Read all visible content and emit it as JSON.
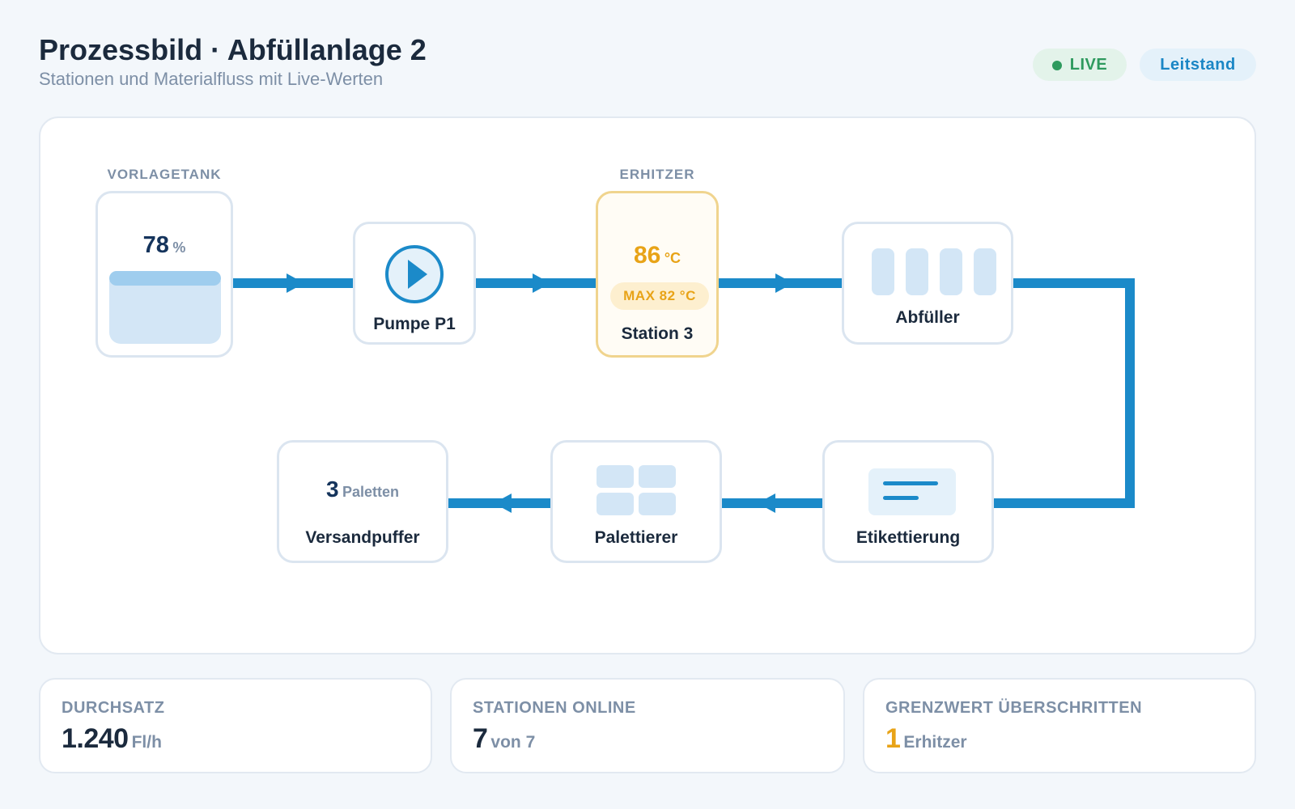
{
  "header": {
    "title": "Prozessbild · Abfüllanlage 2",
    "subtitle": "Stationen und Materialfluss mit Live-Werten"
  },
  "badges": {
    "live": "LIVE",
    "leitstand": "Leitstand"
  },
  "stations": {
    "tank": {
      "caption": "VORLAGETANK",
      "value": "78",
      "unit": "%",
      "fill_percent": 78,
      "icon": "tank-icon"
    },
    "pump": {
      "name": "Pumpe P1",
      "icon": "play-icon"
    },
    "heater": {
      "caption": "ERHITZER",
      "value": "86",
      "unit": "°C",
      "limit": "MAX 82 °C",
      "name": "Station 3"
    },
    "filler": {
      "name": "Abfüller",
      "icon": "bottles-icon"
    },
    "labeler": {
      "name": "Etikettierung",
      "icon": "label-icon"
    },
    "palletizer": {
      "name": "Palettierer",
      "icon": "pallet-grid-icon"
    },
    "buffer": {
      "value": "3",
      "unit": "Paletten",
      "name": "Versandpuffer"
    }
  },
  "kpis": [
    {
      "label": "DURCHSATZ",
      "value": "1.240",
      "unit": "Fl/h"
    },
    {
      "label": "STATIONEN ONLINE",
      "value": "7",
      "unit": "von 7"
    },
    {
      "label": "GRENZWERT ÜBERSCHRITTEN",
      "value": "1",
      "unit": "Erhitzer"
    }
  ],
  "colors": {
    "flow": "#1b8ac9",
    "warning": "#e8a317",
    "live": "#2e9a5e",
    "background": "#f3f7fb"
  }
}
